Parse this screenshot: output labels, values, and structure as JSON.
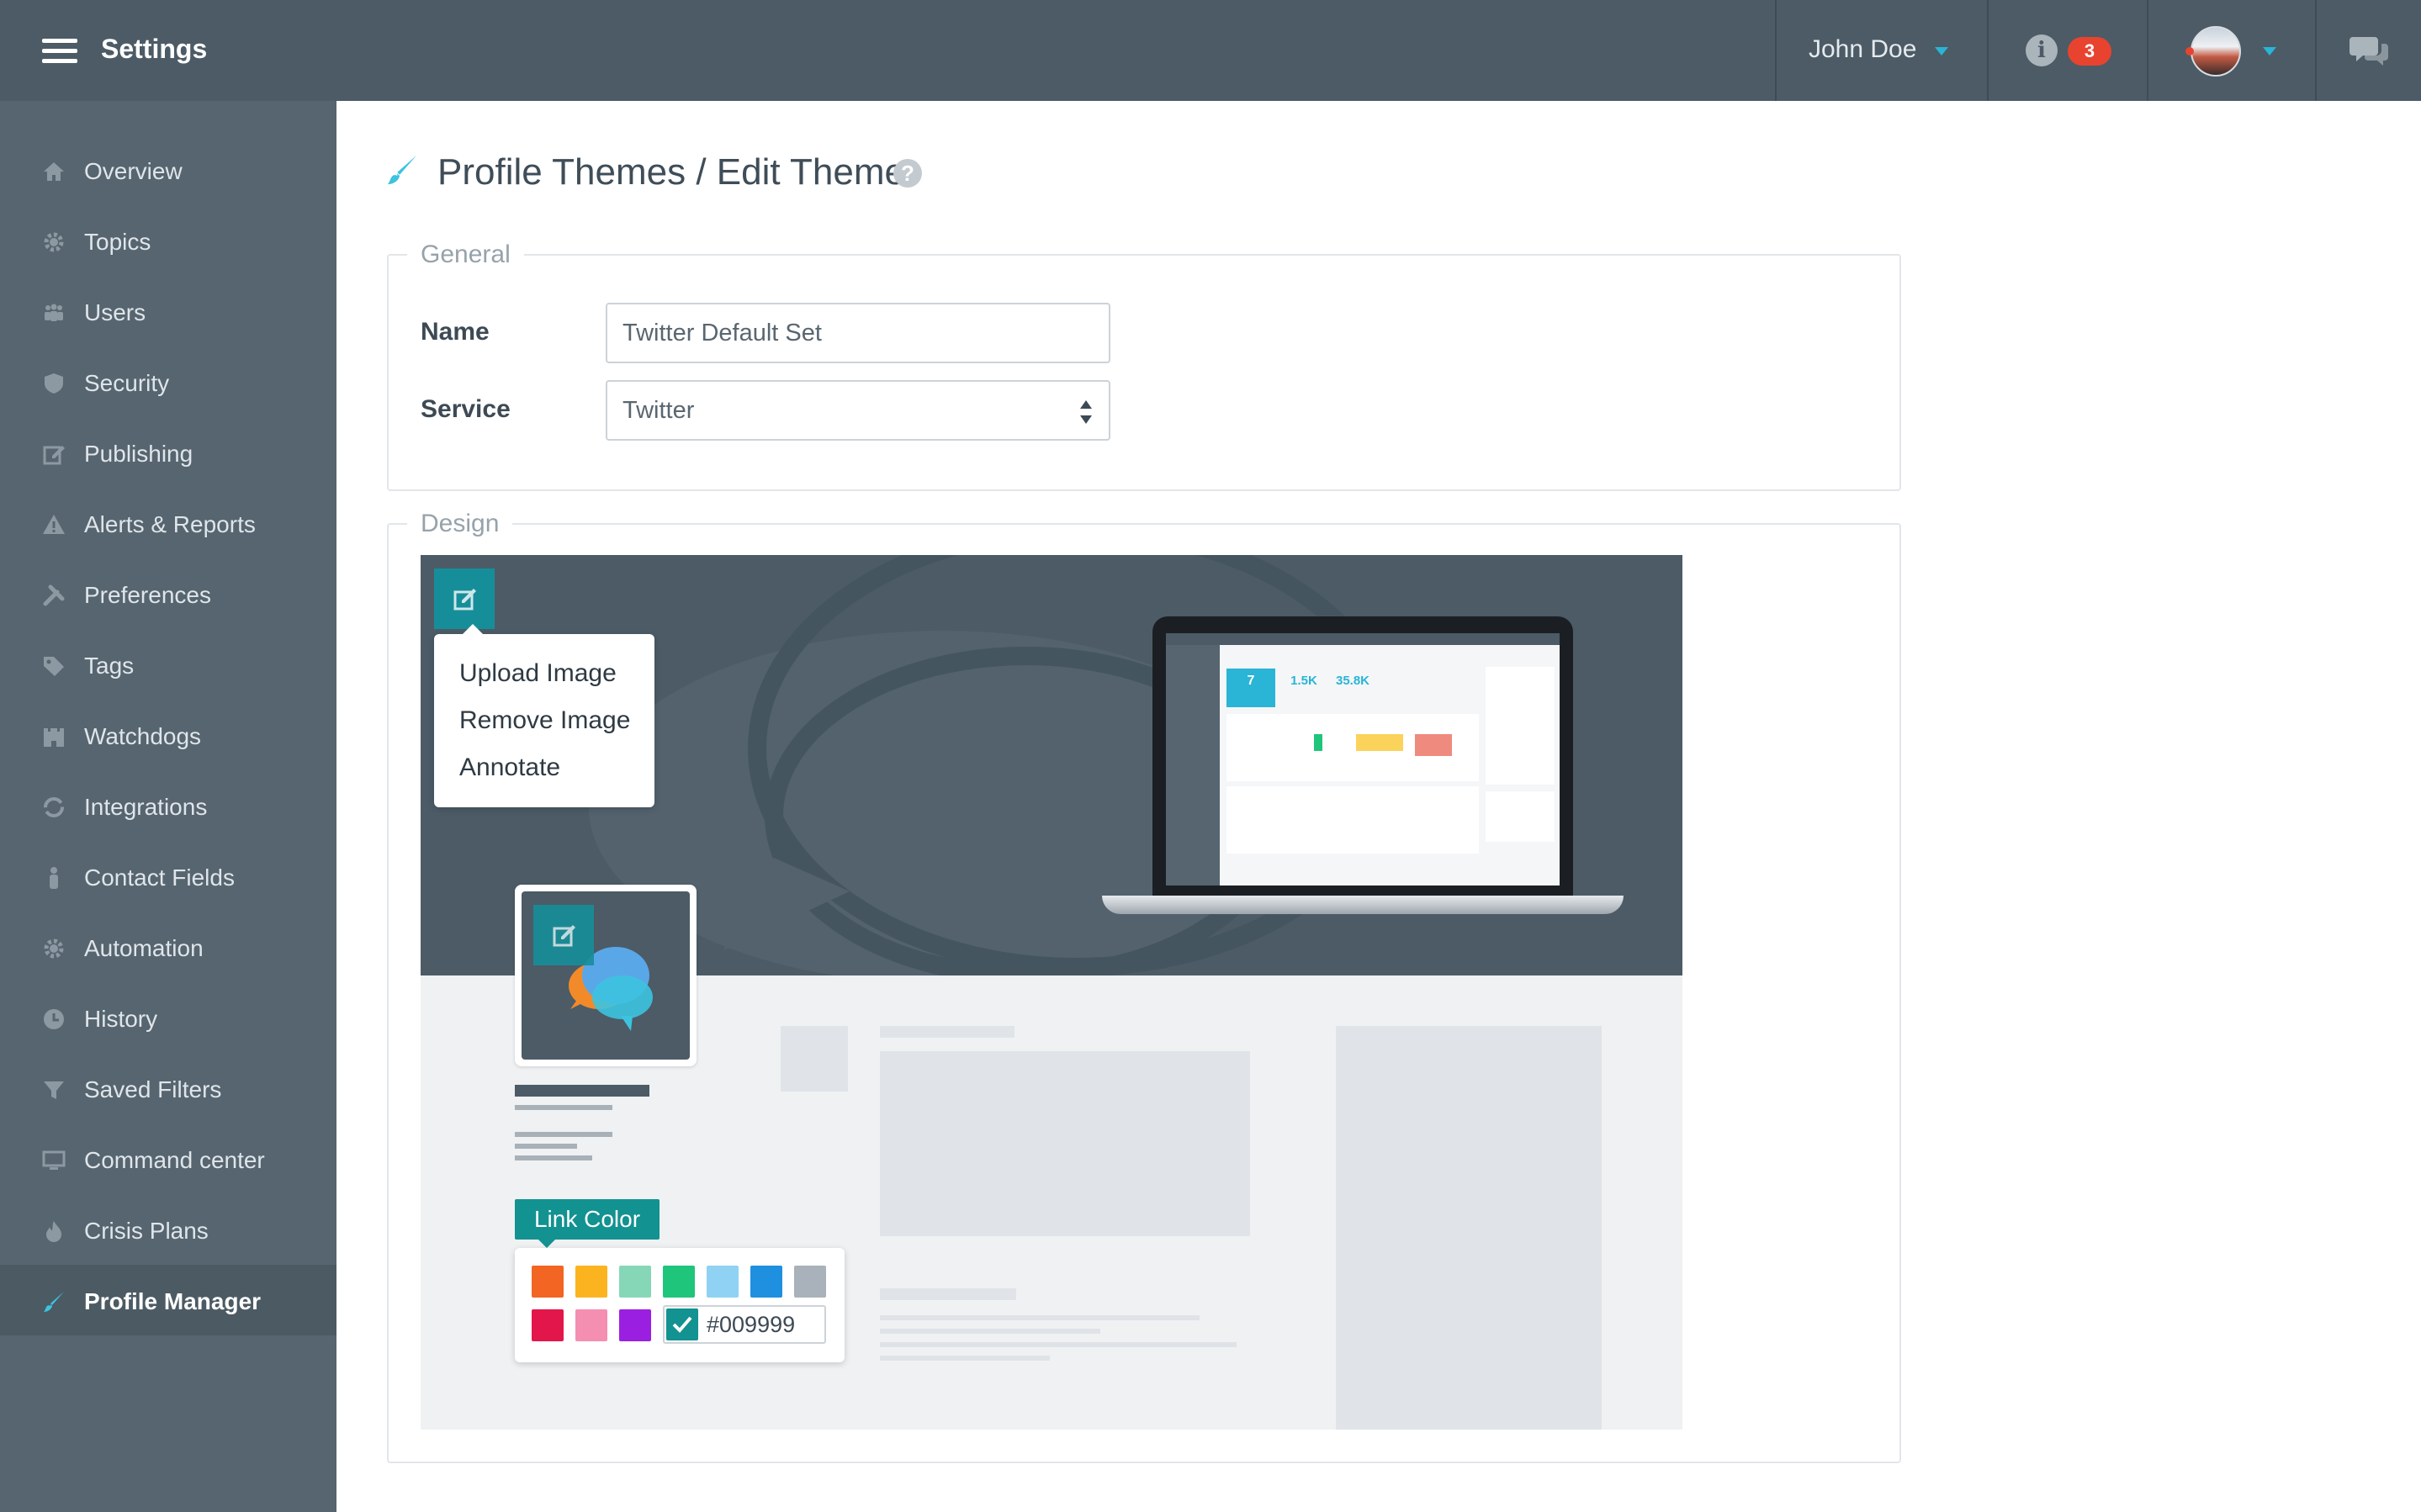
{
  "header": {
    "title": "Settings",
    "user_name": "John Doe",
    "notification_count": "3"
  },
  "sidebar": {
    "items": [
      {
        "label": "Overview",
        "icon": "home-icon"
      },
      {
        "label": "Topics",
        "icon": "gear-icon"
      },
      {
        "label": "Users",
        "icon": "users-icon"
      },
      {
        "label": "Security",
        "icon": "shield-icon"
      },
      {
        "label": "Publishing",
        "icon": "edit-icon"
      },
      {
        "label": "Alerts & Reports",
        "icon": "warning-icon"
      },
      {
        "label": "Preferences",
        "icon": "tools-icon"
      },
      {
        "label": "Tags",
        "icon": "tag-icon"
      },
      {
        "label": "Watchdogs",
        "icon": "castle-icon"
      },
      {
        "label": "Integrations",
        "icon": "refresh-icon"
      },
      {
        "label": "Contact Fields",
        "icon": "person-icon"
      },
      {
        "label": "Automation",
        "icon": "gear-icon"
      },
      {
        "label": "History",
        "icon": "clock-icon"
      },
      {
        "label": "Saved Filters",
        "icon": "filter-icon"
      },
      {
        "label": "Command center",
        "icon": "monitor-icon"
      },
      {
        "label": "Crisis Plans",
        "icon": "fire-icon"
      },
      {
        "label": "Profile Manager",
        "icon": "brush-icon",
        "active": true
      }
    ]
  },
  "page": {
    "title": "Profile Themes / Edit Theme"
  },
  "general": {
    "legend": "General",
    "name_label": "Name",
    "name_value": "Twitter Default Set",
    "service_label": "Service",
    "service_value": "Twitter"
  },
  "design": {
    "legend": "Design",
    "menu": [
      "Upload Image",
      "Remove Image",
      "Annotate"
    ],
    "link_color_label": "Link Color",
    "hex_value": "#009999",
    "swatches_row1": [
      "#f26522",
      "#fbb41f",
      "#86d7b8",
      "#1fc57b",
      "#8fd2f3",
      "#1e90df",
      "#a9b2ba"
    ],
    "swatches_row2": [
      "#e2164a",
      "#f48fb1",
      "#9b1fe0"
    ]
  },
  "laptop": {
    "stat_1": "7",
    "stat_2": "1.5K",
    "stat_3": "35.8K"
  }
}
